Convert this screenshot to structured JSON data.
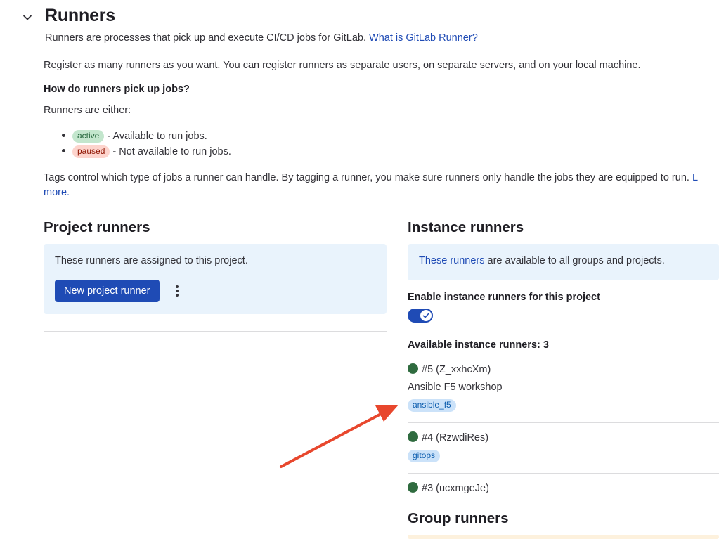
{
  "section": {
    "title": "Runners",
    "intro": "Runners are processes that pick up and execute CI/CD jobs for GitLab.",
    "intro_link": "What is GitLab Runner?",
    "register_text": "Register as many runners as you want. You can register runners as separate users, on separate servers, and on your local machine.",
    "pickup_heading": "How do runners pick up jobs?",
    "either_text": "Runners are either:",
    "states": [
      {
        "badge": "active",
        "desc": "- Available to run jobs."
      },
      {
        "badge": "paused",
        "desc": "- Not available to run jobs."
      }
    ],
    "tags_text": "Tags control which type of jobs a runner can handle. By tagging a runner, you make sure runners only handle the jobs they are equipped to run.",
    "tags_link_start": "L",
    "tags_link_end": "more."
  },
  "project_runners": {
    "title": "Project runners",
    "panel_text": "These runners are assigned to this project.",
    "new_button": "New project runner"
  },
  "instance_runners": {
    "title": "Instance runners",
    "panel_link": "These runners",
    "panel_text": " are available to all groups and projects.",
    "enable_label": "Enable instance runners for this project",
    "toggle_on": true,
    "available_label": "Available instance runners: 3",
    "runners": [
      {
        "name": "#5 (Z_xxhcXm)",
        "description": "Ansible F5 workshop",
        "tag": "ansible_f5"
      },
      {
        "name": "#4 (RzwdiRes)",
        "tag": "gitops"
      },
      {
        "name": "#3 (ucxmgeJe)"
      }
    ]
  },
  "group_runners": {
    "title": "Group runners"
  },
  "colors": {
    "primary": "#1f4bb5",
    "panel_bg": "#e9f3fc",
    "status_online": "#2f6b3f",
    "annotation_arrow": "#e8472d"
  }
}
